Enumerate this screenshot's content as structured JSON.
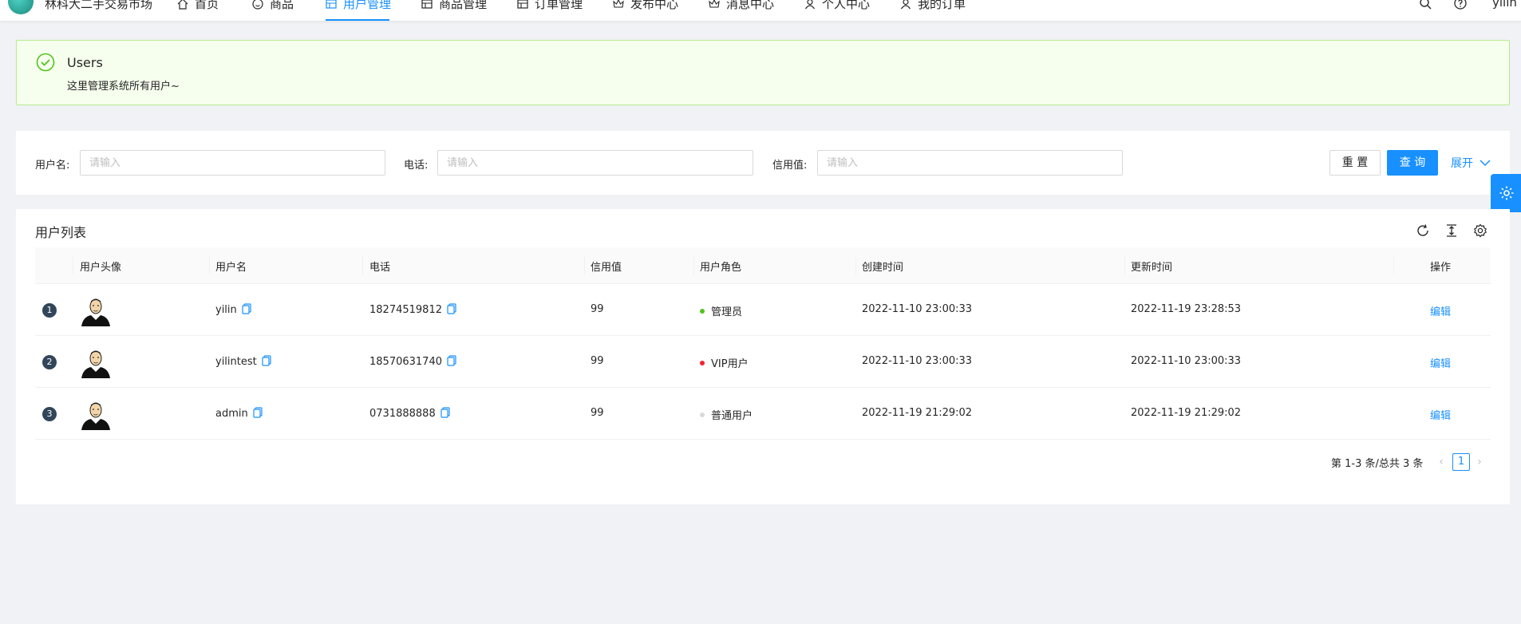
{
  "app": {
    "brand": "林科大二手交易市场",
    "username": "yilin"
  },
  "nav": [
    {
      "label": "首页",
      "icon": "home-icon"
    },
    {
      "label": "商品",
      "icon": "smile-icon"
    },
    {
      "label": "用户管理",
      "icon": "table-icon",
      "active": true
    },
    {
      "label": "商品管理",
      "icon": "table-icon"
    },
    {
      "label": "订单管理",
      "icon": "table-icon"
    },
    {
      "label": "发布中心",
      "icon": "crown-icon"
    },
    {
      "label": "消息中心",
      "icon": "crown-icon"
    },
    {
      "label": "个人中心",
      "icon": "user-icon"
    },
    {
      "label": "我的订单",
      "icon": "user-icon"
    }
  ],
  "alert": {
    "title": "Users",
    "description": "这里管理系统所有用户~"
  },
  "search": {
    "username_label": "用户名:",
    "phone_label": "电话:",
    "credit_label": "信用值:",
    "placeholder": "请输入",
    "reset_label": "重 置",
    "query_label": "查 询",
    "expand_label": "展开"
  },
  "table": {
    "title": "用户列表",
    "columns": {
      "avatar": "用户头像",
      "username": "用户名",
      "phone": "电话",
      "credit": "信用值",
      "role": "用户角色",
      "created": "创建时间",
      "updated": "更新时间",
      "action": "操作"
    },
    "rows": [
      {
        "index": "1",
        "username": "yilin",
        "phone": "18274519812",
        "credit": "99",
        "role": "管理员",
        "role_color": "#52c41a",
        "created": "2022-11-10 23:00:33",
        "updated": "2022-11-19 23:28:53",
        "action": "编辑"
      },
      {
        "index": "2",
        "username": "yilintest",
        "phone": "18570631740",
        "credit": "99",
        "role": "VIP用户",
        "role_color": "#f5222d",
        "created": "2022-11-10 23:00:33",
        "updated": "2022-11-10 23:00:33",
        "action": "编辑"
      },
      {
        "index": "3",
        "username": "admin",
        "phone": "0731888888",
        "credit": "99",
        "role": "普通用户",
        "role_color": "#d9d9d9",
        "created": "2022-11-19 21:29:02",
        "updated": "2022-11-19 21:29:02",
        "action": "编辑"
      }
    ]
  },
  "pagination": {
    "summary": "第 1-3 条/总共 3 条",
    "current": "1"
  },
  "colors": {
    "primary": "#1890ff",
    "success_bg": "#f6ffed",
    "success_border": "#b7eb8f"
  }
}
